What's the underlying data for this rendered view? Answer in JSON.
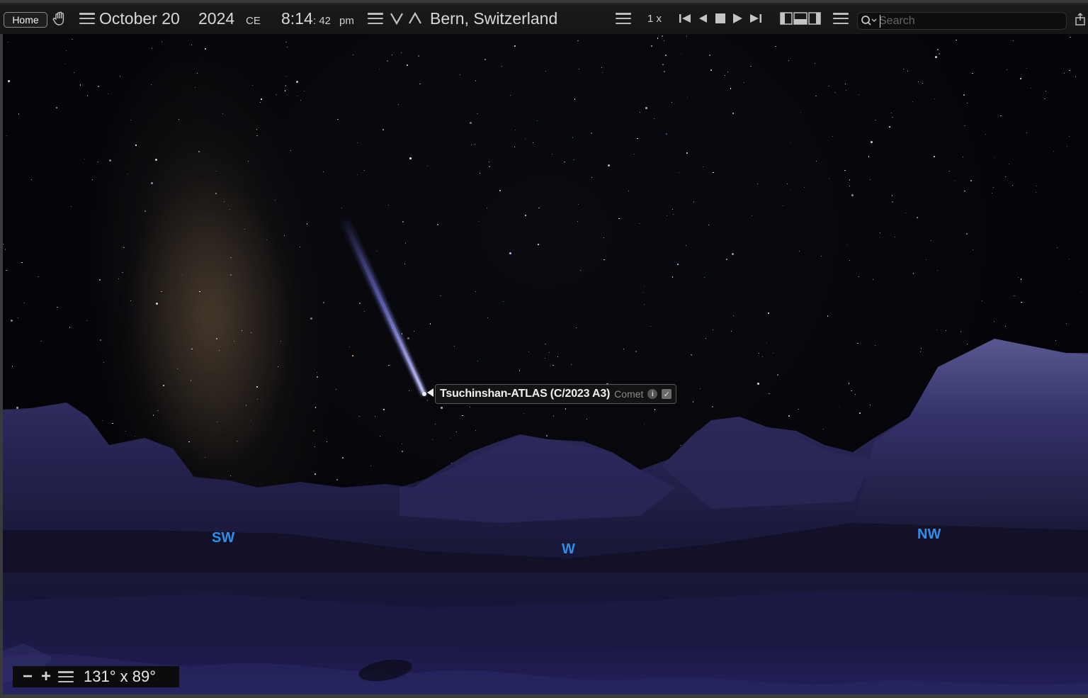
{
  "toolbar": {
    "home_label": "Home",
    "date": "October 20",
    "year": "2024",
    "era": "CE",
    "time_hm": "8:14",
    "time_sec": ": 42",
    "ampm": "pm",
    "location": "Bern, Switzerland",
    "speed": "1 x",
    "search_placeholder": "Search",
    "icons": [
      "hand-icon",
      "menu-icon",
      "down-arrow-icon",
      "up-arrow-icon",
      "skip-back-icon",
      "step-back-icon",
      "stop-icon",
      "play-icon",
      "skip-forward-icon",
      "panel-layout-icon",
      "search-icon",
      "share-icon"
    ]
  },
  "sky": {
    "comet_name": "Tsuchinshan-ATLAS (C/2023 A3)",
    "comet_type": "Comet",
    "info_symbol": "i",
    "check_symbol": "✓",
    "compass": {
      "sw": "SW",
      "w": "W",
      "nw": "NW"
    }
  },
  "fov": {
    "minus": "−",
    "plus": "+",
    "value": "131° x 89°"
  },
  "colors": {
    "accent_compass": "#2f8fe8",
    "mountain": "#2a2858",
    "water": "#141232"
  }
}
